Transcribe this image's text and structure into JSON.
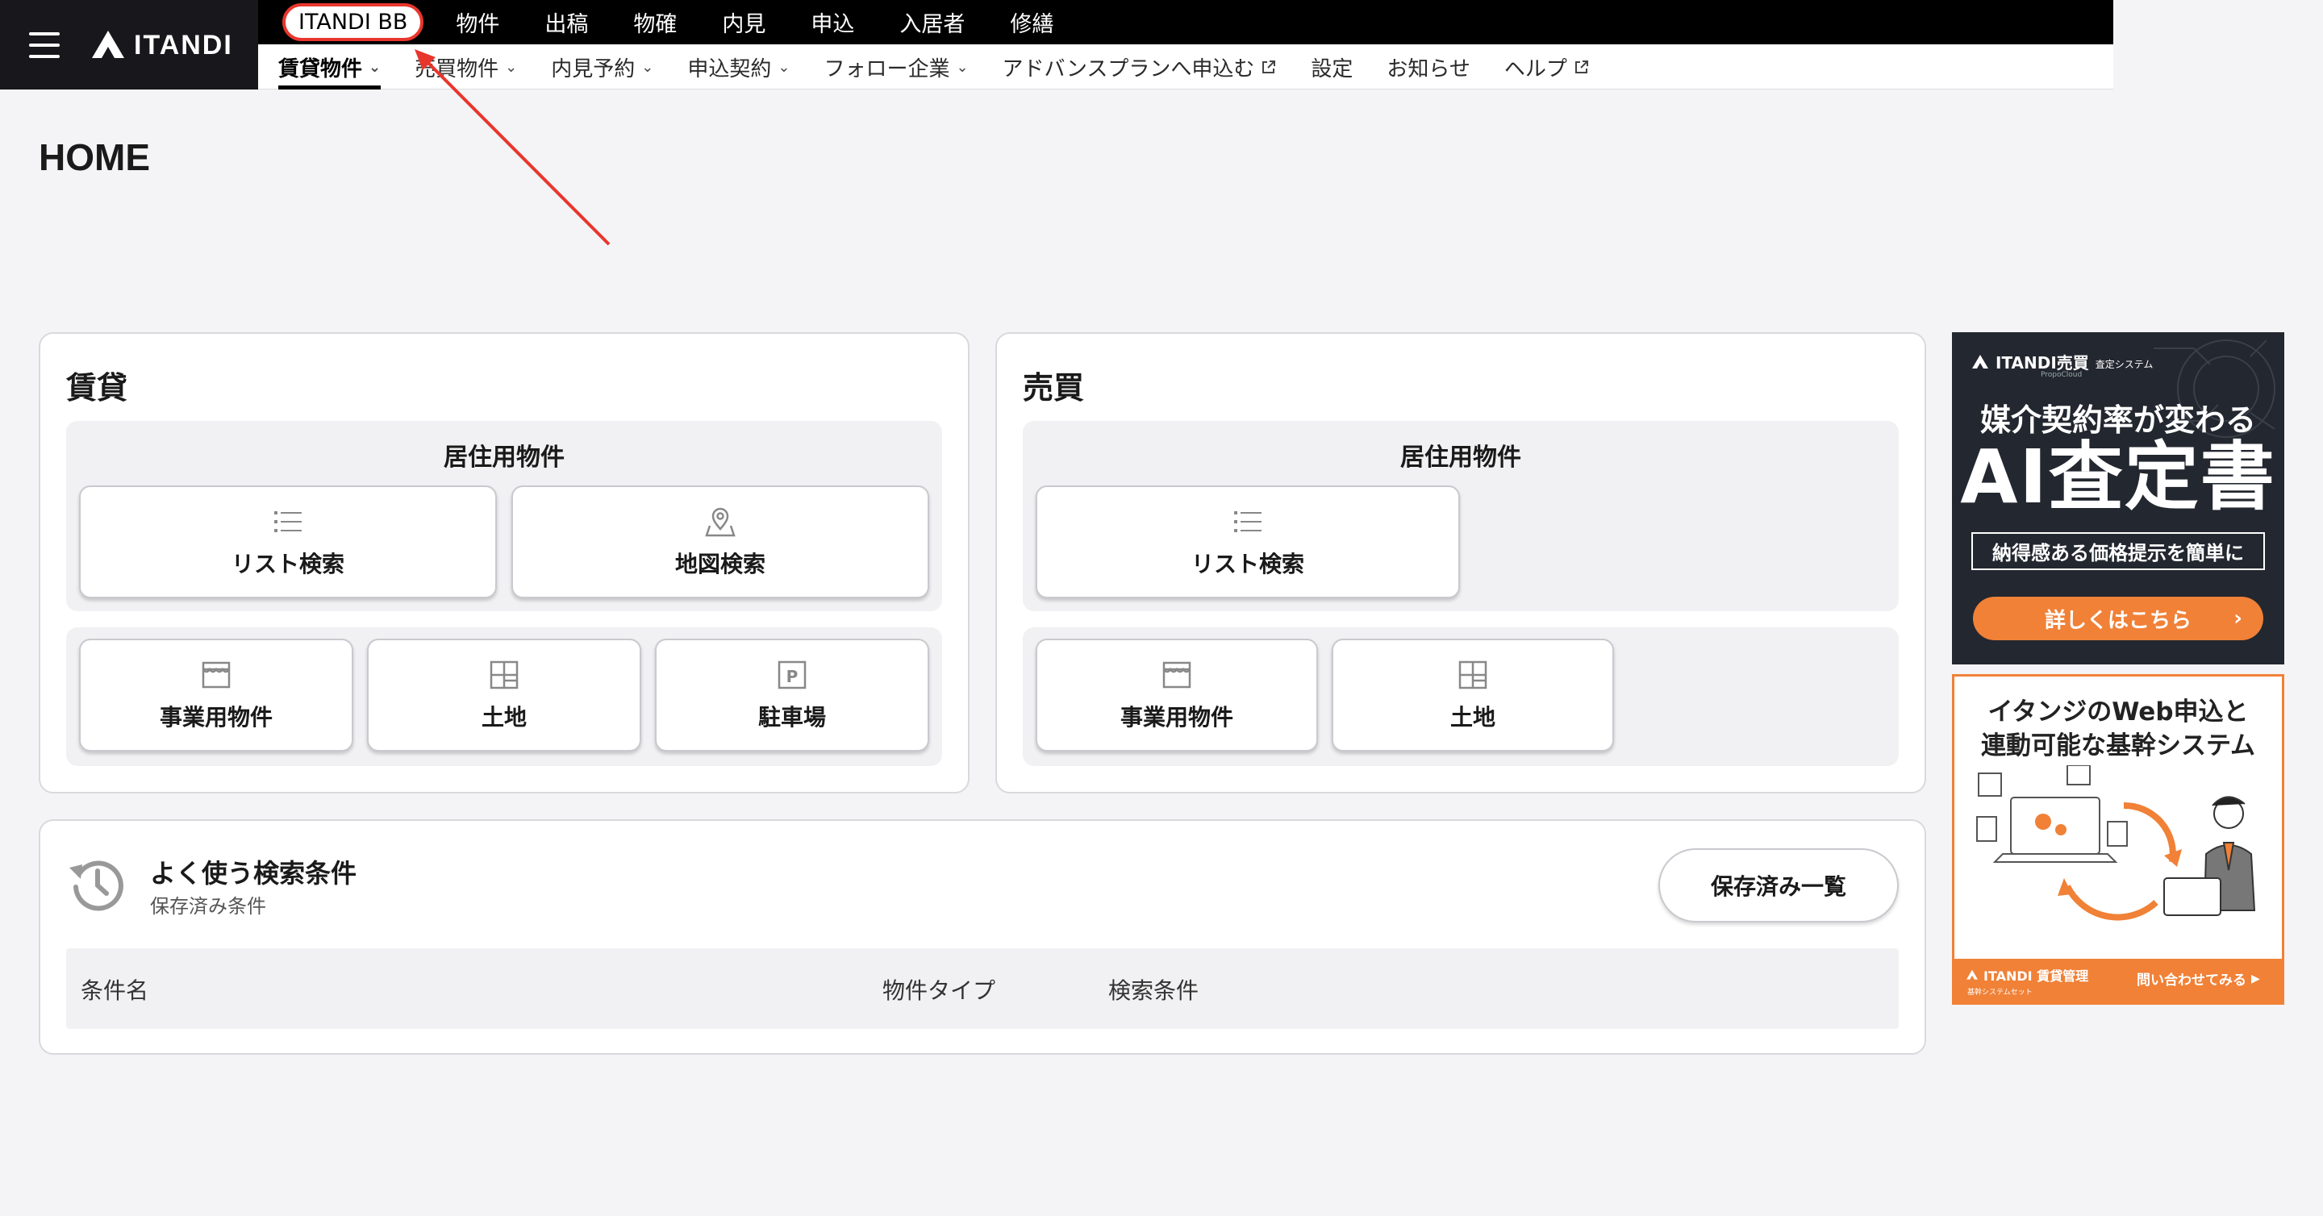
{
  "header": {
    "logo_text": "ITANDI",
    "top_nav": [
      "ITANDI BB",
      "物件",
      "出稿",
      "物確",
      "内見",
      "申込",
      "入居者",
      "修繕"
    ],
    "sub_nav": [
      {
        "label": "賃貸物件",
        "chevron": true,
        "external": false,
        "active": true
      },
      {
        "label": "売買物件",
        "chevron": true,
        "external": false,
        "active": false
      },
      {
        "label": "内見予約",
        "chevron": true,
        "external": false,
        "active": false
      },
      {
        "label": "申込契約",
        "chevron": true,
        "external": false,
        "active": false
      },
      {
        "label": "フォロー企業",
        "chevron": true,
        "external": false,
        "active": false
      },
      {
        "label": "アドバンスプランへ申込む",
        "chevron": false,
        "external": true,
        "active": false
      },
      {
        "label": "設定",
        "chevron": false,
        "external": false,
        "active": false
      },
      {
        "label": "お知らせ",
        "chevron": false,
        "external": false,
        "active": false
      },
      {
        "label": "ヘルプ",
        "chevron": false,
        "external": true,
        "active": false
      }
    ]
  },
  "page_title": "HOME",
  "rent_card": {
    "title": "賃貸",
    "residential_title": "居住用物件",
    "list_search": "リスト検索",
    "map_search": "地図検索",
    "business": "事業用物件",
    "land": "土地",
    "parking": "駐車場"
  },
  "sale_card": {
    "title": "売買",
    "residential_title": "居住用物件",
    "list_search": "リスト検索",
    "business": "事業用物件",
    "land": "土地"
  },
  "saved_searches": {
    "title": "よく使う検索条件",
    "subtitle": "保存済み条件",
    "button": "保存済み一覧",
    "columns": [
      "条件名",
      "物件タイプ",
      "検索条件"
    ]
  },
  "ad1": {
    "brand": "ITANDI売買",
    "brand_sub": "査定システム",
    "brand_small": "PropoCloud",
    "headline": "媒介契約率が変わる",
    "big": "AI査定書",
    "tagline": "納得感ある価格提示を簡単に",
    "cta": "詳しくはこちら",
    "cta_color": "#f08137"
  },
  "ad2": {
    "headline1": "イタンジのWeb申込と",
    "headline2": "連動可能な基幹システム",
    "brand": "ITANDI 賃貸管理",
    "brand_sub": "基幹システムセット",
    "cta": "問い合わせてみる",
    "accent": "#f08137"
  },
  "annotation_color": "#e8362d"
}
